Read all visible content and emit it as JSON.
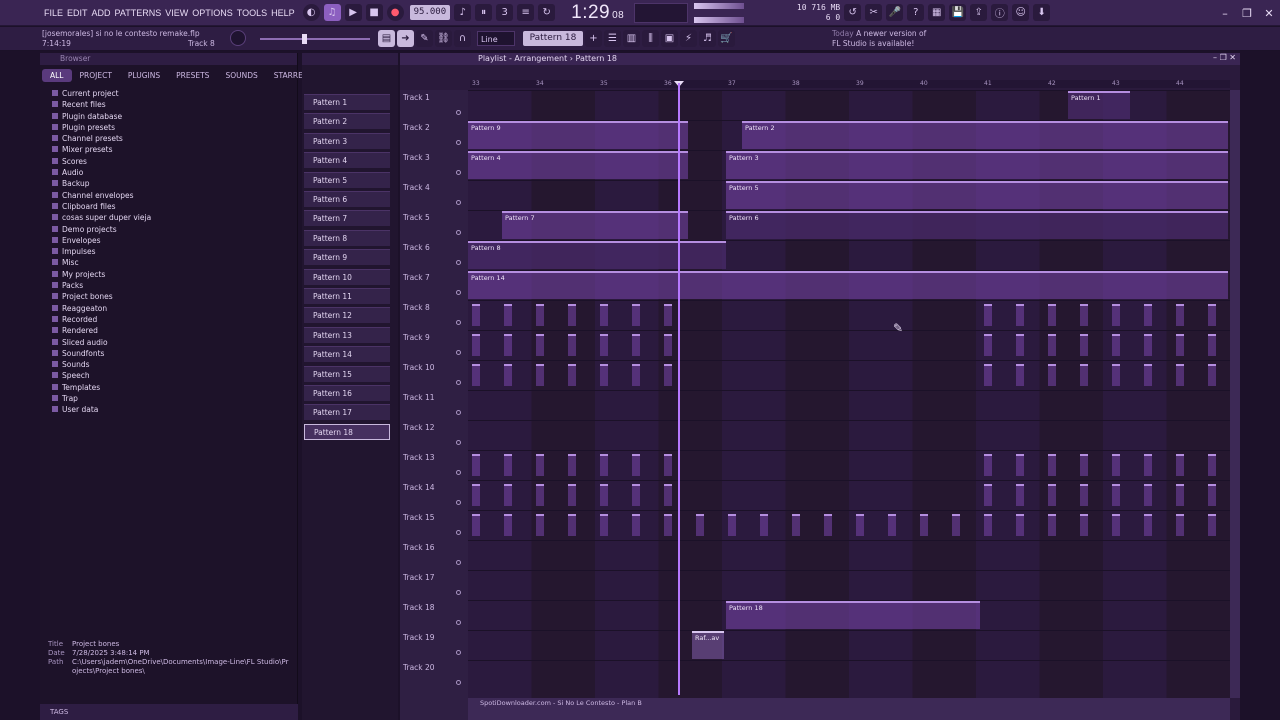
{
  "menu": [
    "FILE",
    "EDIT",
    "ADD",
    "PATTERNS",
    "VIEW",
    "OPTIONS",
    "TOOLS",
    "HELP"
  ],
  "transport": {
    "tempo": "95.000",
    "time": "1:29",
    "time_small": "08",
    "time_unit": "M:S:CS",
    "cpu_top": "10",
    "cpu_bottom": "6",
    "mem": "716 MB",
    "mem2": "0"
  },
  "project": {
    "owner": "[josemorales] si no le contesto remake.flp",
    "elapsed": "7:14:19",
    "hint": "Track 8"
  },
  "toolbar": {
    "snap": "Line",
    "pattern": "Pattern 18"
  },
  "news": {
    "day": "Today",
    "line1": "A newer version of",
    "line2": "FL Studio is available!"
  },
  "browser": {
    "title": "Browser",
    "tabs": [
      "ALL",
      "PROJECT",
      "PLUGINS",
      "PRESETS",
      "SOUNDS",
      "STARRED"
    ],
    "items": [
      "Current project",
      "Recent files",
      "Plugin database",
      "Plugin presets",
      "Channel presets",
      "Mixer presets",
      "Scores",
      "Audio",
      "Backup",
      "Channel envelopes",
      "Clipboard files",
      "cosas super duper vieja",
      "Demo projects",
      "Envelopes",
      "Impulses",
      "Misc",
      "My projects",
      "Packs",
      "Project bones",
      "Reaggeaton",
      "Recorded",
      "Rendered",
      "Sliced audio",
      "Soundfonts",
      "Sounds",
      "Speech",
      "Templates",
      "Trap",
      "User data"
    ],
    "meta": {
      "title_label": "Title",
      "title_value": "Project bones",
      "date_label": "Date",
      "date_value": "7/28/2025 3:48:14 PM",
      "path_label": "Path",
      "path_value": "C:\\Users\\jadem\\OneDrive\\Documents\\Image-Line\\FL Studio\\Projects\\Project bones\\"
    },
    "footer": "TAGS"
  },
  "patterns": [
    "Pattern 1",
    "Pattern 2",
    "Pattern 3",
    "Pattern 4",
    "Pattern 5",
    "Pattern 6",
    "Pattern 7",
    "Pattern 8",
    "Pattern 9",
    "Pattern 10",
    "Pattern 11",
    "Pattern 12",
    "Pattern 13",
    "Pattern 14",
    "Pattern 15",
    "Pattern 16",
    "Pattern 17",
    "Pattern 18"
  ],
  "playlist": {
    "title": "Playlist - Arrangement",
    "current_pattern": "Pattern 18",
    "bars": [
      "33",
      "34",
      "35",
      "36",
      "37",
      "38",
      "39",
      "40",
      "41",
      "42",
      "43",
      "44"
    ],
    "tracks": [
      "Track 1",
      "Track 2",
      "Track 3",
      "Track 4",
      "Track 5",
      "Track 6",
      "Track 7",
      "Track 8",
      "Track 9",
      "Track 10",
      "Track 11",
      "Track 12",
      "Track 13",
      "Track 14",
      "Track 15",
      "Track 16",
      "Track 17",
      "Track 18",
      "Track 19",
      "Track 20"
    ],
    "clips": [
      {
        "row": 0,
        "start": 600,
        "width": 62,
        "label": "Pattern 1",
        "kind": "dark"
      },
      {
        "row": 1,
        "start": 0,
        "width": 220,
        "label": "Pattern 9",
        "kind": "normal"
      },
      {
        "row": 1,
        "start": 274,
        "width": 486,
        "label": "Pattern 2",
        "kind": "normal"
      },
      {
        "row": 2,
        "start": 0,
        "width": 220,
        "label": "Pattern 4",
        "kind": "normal"
      },
      {
        "row": 2,
        "start": 258,
        "width": 502,
        "label": "Pattern 3",
        "kind": "normal"
      },
      {
        "row": 3,
        "start": 258,
        "width": 502,
        "label": "Pattern 5",
        "kind": "normal"
      },
      {
        "row": 4,
        "start": 34,
        "width": 186,
        "label": "Pattern 7",
        "kind": "normal"
      },
      {
        "row": 4,
        "start": 258,
        "width": 502,
        "label": "Pattern 6",
        "kind": "dark"
      },
      {
        "row": 5,
        "start": 0,
        "width": 258,
        "label": "Pattern 8",
        "kind": "dark"
      },
      {
        "row": 6,
        "start": 0,
        "width": 760,
        "label": "Pattern 14",
        "kind": "normal"
      },
      {
        "row": 17,
        "start": 258,
        "width": 254,
        "label": "Pattern 18",
        "kind": "normal"
      },
      {
        "row": 18,
        "start": 224,
        "width": 32,
        "label": "Raf...av",
        "kind": "audio"
      }
    ],
    "footer_clip": "SpotiDownloader.com - Si No Le Contesto - Plan B"
  },
  "colors": {
    "accent": "#b779ff",
    "bg": "#1c1129"
  }
}
